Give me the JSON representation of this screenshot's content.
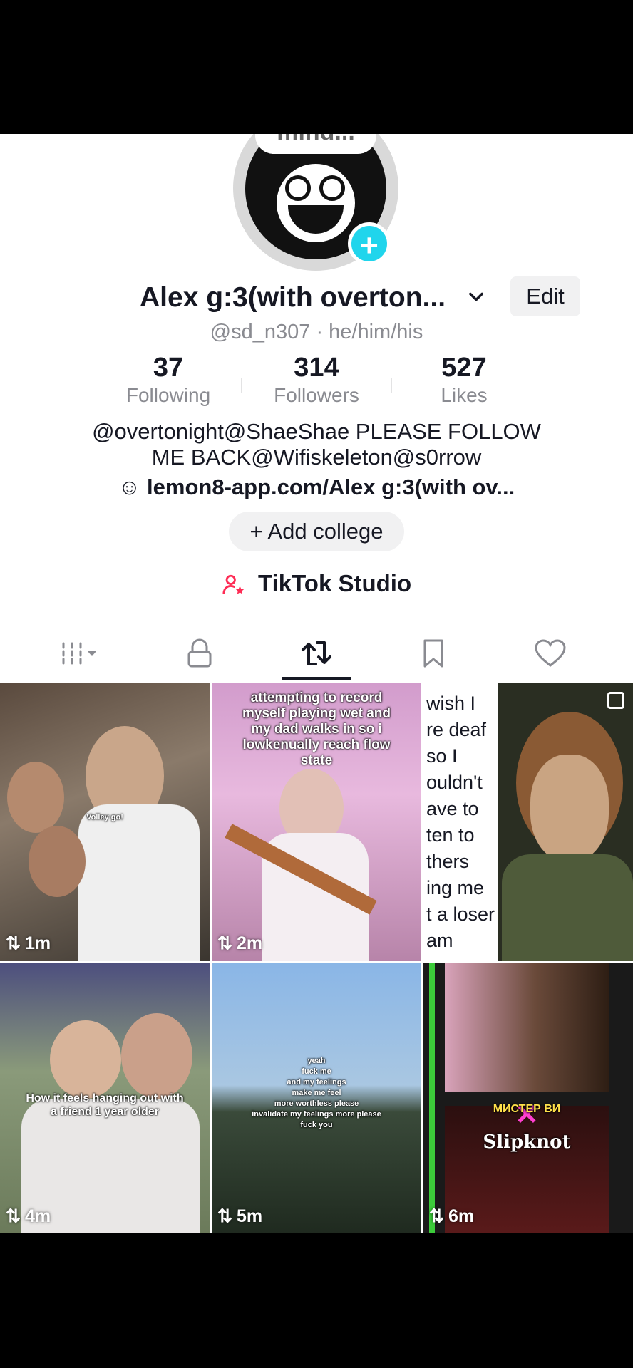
{
  "avatar": {
    "bubble_text": "mind...",
    "add_icon": "plus-icon"
  },
  "profile": {
    "name": "Alex g:3(with overton...",
    "handle": "@sd_n307 · he/him/his",
    "edit_label": "Edit",
    "stats": [
      {
        "value": "37",
        "label": "Following"
      },
      {
        "value": "314",
        "label": "Followers"
      },
      {
        "value": "527",
        "label": "Likes"
      }
    ],
    "bio_line1": "@overtonight@ShaeShae  PLEASE FOLLOW",
    "bio_line2": "ME BACK@Wifiskeleton@s0rrow",
    "link": "lemon8-app.com/Alex g:3(with ov...",
    "add_college": "+ Add college",
    "studio": "TikTok Studio"
  },
  "tabs": [
    {
      "icon": "grid-icon",
      "active": false
    },
    {
      "icon": "lock-icon",
      "active": false
    },
    {
      "icon": "repost-icon",
      "active": true
    },
    {
      "icon": "bookmark-icon",
      "active": false
    },
    {
      "icon": "heart-icon",
      "active": false
    }
  ],
  "videos": [
    {
      "caption": "Volley go!",
      "time": "1m"
    },
    {
      "caption": "attempting to record myself playing wet and my dad walks in so i lowkenually reach flow state",
      "time": "2m"
    },
    {
      "caption": "wish I\nre deaf\nso I\nouldn't\nave to\nten to\nthers\ning me\nt a loser\nam",
      "time": ""
    },
    {
      "caption": "How it feels hanging out with a friend 1 year older",
      "time": "4m"
    },
    {
      "caption": "yeah\nfuck me\nand my feelings\nmake me feel\nmore worthless please\ninvalidate my feelings more please\nfuck you",
      "time": "5m"
    },
    {
      "caption": "МИСТЕР ВИ",
      "caption2": "Slipknot",
      "time": "6m"
    }
  ],
  "colors": {
    "accent": "#20d5ec",
    "studio_icon": "#fe2c55"
  }
}
